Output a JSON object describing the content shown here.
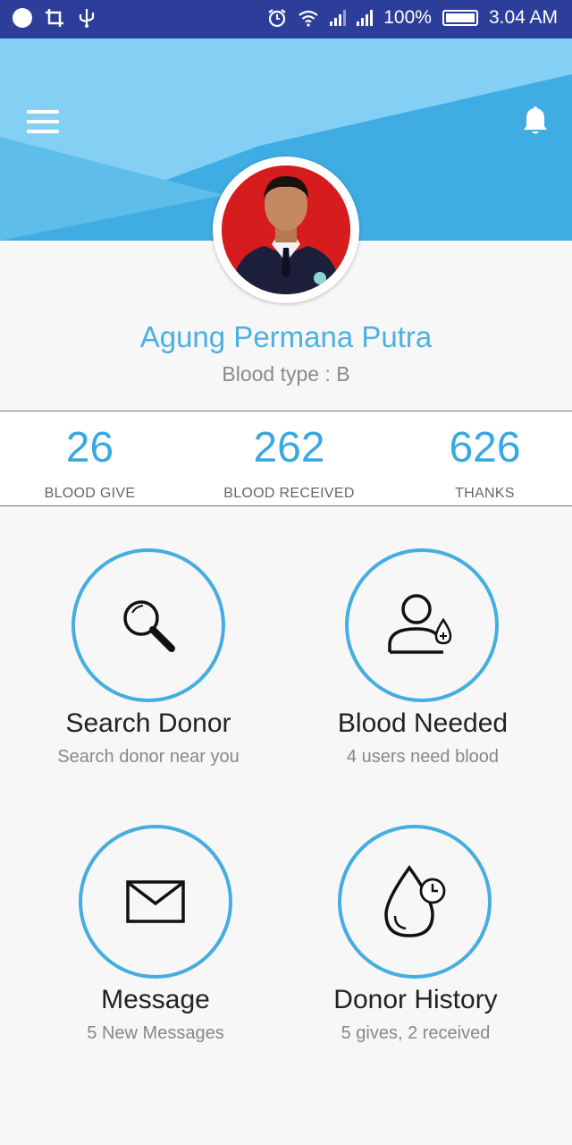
{
  "status_bar": {
    "battery": "100%",
    "time": "3.04 AM"
  },
  "header": {
    "menu_icon": "hamburger-menu-icon",
    "notification_icon": "bell-icon",
    "colors": {
      "light": "#84d0f5",
      "mid": "#5fbdea",
      "dark": "#3fade3"
    }
  },
  "profile": {
    "name": "Agung Permana Putra",
    "blood_type": "Blood type : B"
  },
  "stats": [
    {
      "value": "26",
      "label": "BLOOD GIVE"
    },
    {
      "value": "262",
      "label": "BLOOD RECEIVED"
    },
    {
      "value": "626",
      "label": "THANKS"
    }
  ],
  "menu": [
    {
      "title": "Search Donor",
      "subtitle": "Search donor near you",
      "icon": "search-icon"
    },
    {
      "title": "Blood Needed",
      "subtitle": "4 users need blood",
      "icon": "user-blood-icon"
    },
    {
      "title": "Message",
      "subtitle": "5 New Messages",
      "icon": "envelope-icon"
    },
    {
      "title": "Donor History",
      "subtitle": "5 gives, 2 received",
      "icon": "blood-drop-clock-icon"
    }
  ],
  "accent_color": "#45ade0"
}
